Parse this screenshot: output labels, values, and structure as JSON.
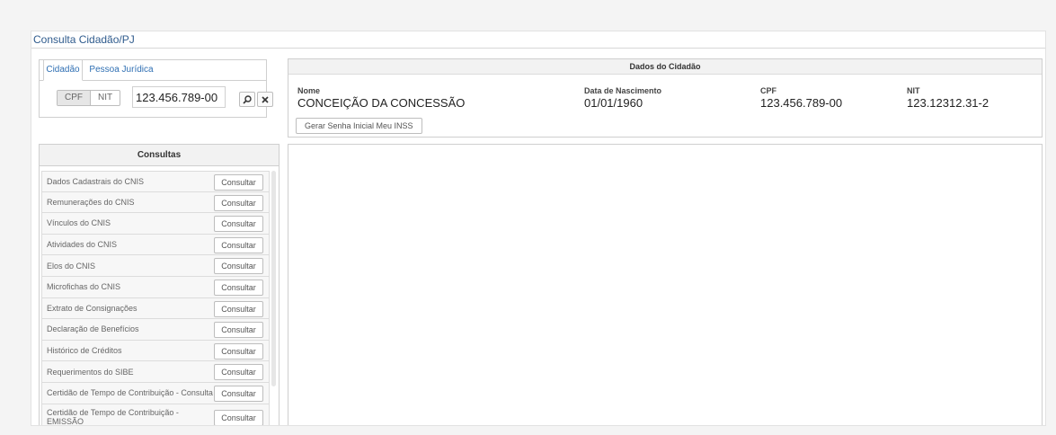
{
  "page": {
    "title": "Consulta Cidadão/PJ"
  },
  "search": {
    "tabs": [
      "Cidadão",
      "Pessoa Jurídica"
    ],
    "doc_types": [
      "CPF",
      "NIT"
    ],
    "value": "123.456.789-00",
    "search_icon": "search-icon",
    "clear_icon": "close-icon"
  },
  "consultas": {
    "title": "Consultas",
    "button_label": "Consultar",
    "items": [
      "Dados Cadastrais do CNIS",
      "Remunerações do CNIS",
      "Vínculos do CNIS",
      "Atividades do CNIS",
      "Elos do CNIS",
      "Microfichas do CNIS",
      "Extrato de Consignações",
      "Declaração de Benefícios",
      "Histórico de Créditos",
      "Requerimentos do SIBE",
      "Certidão de Tempo de Contribuição - Consulta",
      "Certidão de Tempo de Contribuição - EMISSÃO"
    ]
  },
  "dados": {
    "title": "Dados do Cidadão",
    "fields": [
      {
        "label": "Nome",
        "value": "CONCEIÇÃO DA CONCESSÃO"
      },
      {
        "label": "Data de Nascimento",
        "value": "01/01/1960"
      },
      {
        "label": "CPF",
        "value": "123.456.789-00"
      },
      {
        "label": "NIT",
        "value": "123.12312.31-2"
      }
    ],
    "senha_button": "Gerar Senha Inicial Meu INSS"
  },
  "colors": {
    "link": "#2f6fb3",
    "title": "#2f5b8d",
    "border": "#cfcfcf"
  }
}
